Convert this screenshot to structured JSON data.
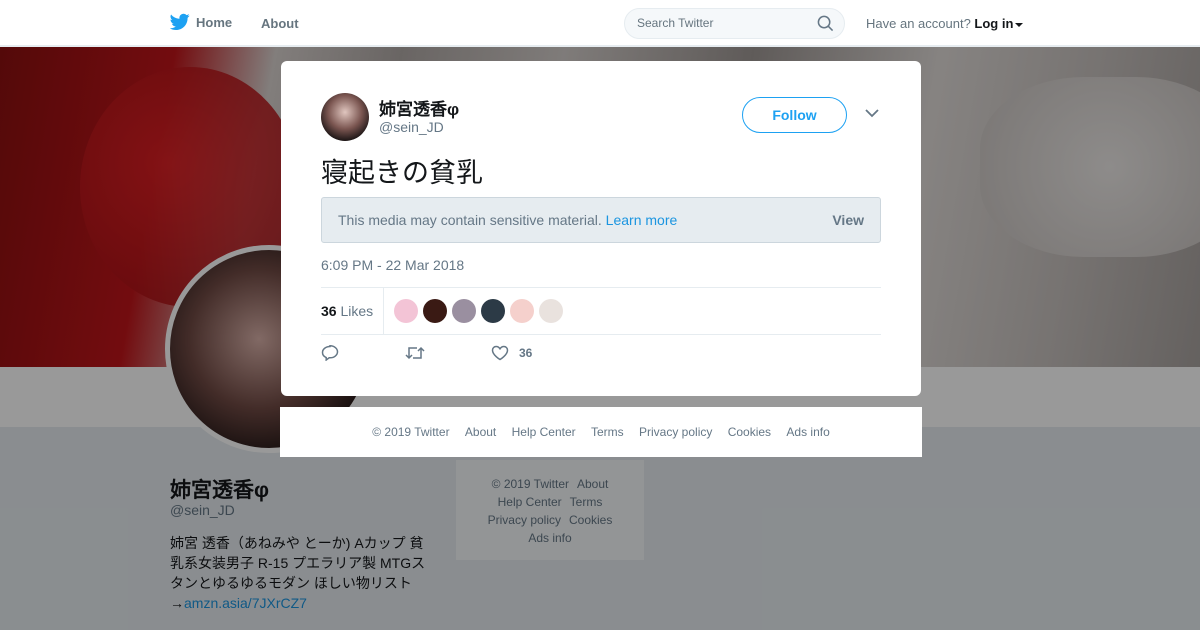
{
  "topbar": {
    "home_label": "Home",
    "about_label": "About",
    "search_placeholder": "Search Twitter",
    "account_prompt": "Have an account?",
    "login_label": "Log in"
  },
  "profile": {
    "name": "姉宮透香φ",
    "handle": "@sein_JD",
    "bio_line1": "姉宮 透香（あねみや とーか) Aカップ 貧",
    "bio_line2": "乳系女装男子 R-15 プエラリア製 MTGス",
    "bio_line3": "タンとゆるゆるモダン ほしい物リスト",
    "bio_arrow": "→",
    "bio_link": "amzn.asia/7JXrCZ7"
  },
  "side_footer": {
    "copyright": "© 2019 Twitter",
    "about": "About",
    "help": "Help Center",
    "terms": "Terms",
    "privacy": "Privacy policy",
    "cookies": "Cookies",
    "ads": "Ads info"
  },
  "tweet": {
    "name": "姉宮透香φ",
    "handle": "@sein_JD",
    "follow_label": "Follow",
    "text": "寝起きの貧乳",
    "sensitive_text": "This media may contain sensitive material.",
    "learn_more": "Learn more",
    "view_label": "View",
    "timestamp": "6:09 PM - 22 Mar 2018",
    "likes_count": "36",
    "likes_label": "Likes",
    "like_action_count": "36",
    "liker_colors": [
      "#f3c4d6",
      "#3a1a14",
      "#9a8fa0",
      "#2c3a46",
      "#f5d0cc",
      "#e9e2de"
    ]
  },
  "modal_footer": {
    "copyright": "© 2019 Twitter",
    "about": "About",
    "help": "Help Center",
    "terms": "Terms",
    "privacy": "Privacy policy",
    "cookies": "Cookies",
    "ads": "Ads info"
  },
  "colors": {
    "brand": "#1da1f2",
    "link": "#1b95e0",
    "muted": "#657786"
  }
}
